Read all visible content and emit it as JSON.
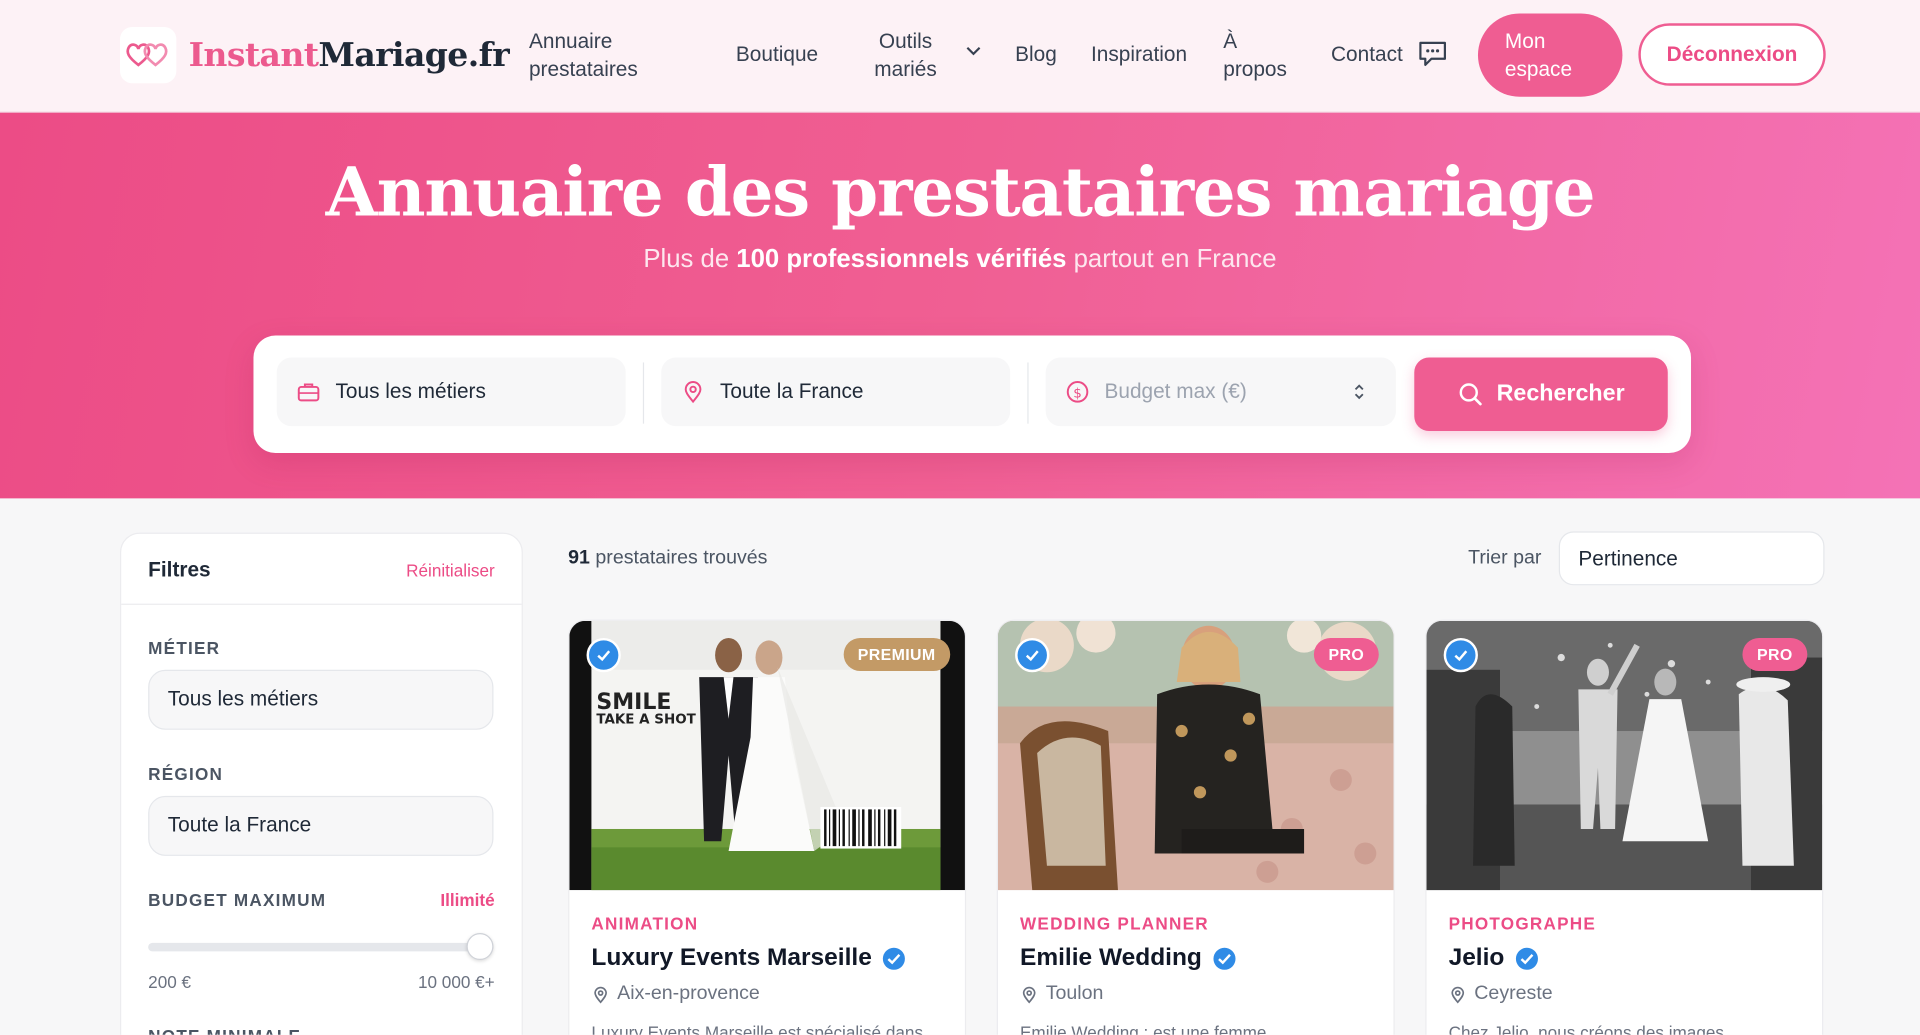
{
  "header": {
    "logo_a": "Instant",
    "logo_b": "Mariage.fr",
    "nav": {
      "annuaire_1": "Annuaire",
      "annuaire_2": "prestataires",
      "boutique": "Boutique",
      "outils_1": "Outils",
      "outils_2": "mariés",
      "blog": "Blog",
      "inspiration": "Inspiration",
      "apropos_1": "À",
      "apropos_2": "propos",
      "contact": "Contact"
    },
    "mon_espace_1": "Mon",
    "mon_espace_2": "espace",
    "deconnexion": "Déconnexion"
  },
  "hero": {
    "title": "Annuaire des prestataires mariage",
    "subtitle_pre": "Plus de ",
    "subtitle_bold": "100 professionnels vérifiés",
    "subtitle_post": " partout en France"
  },
  "search": {
    "metier": "Tous les métiers",
    "region": "Toute la France",
    "budget_placeholder": "Budget max (€)",
    "button": "Rechercher"
  },
  "filters": {
    "title": "Filtres",
    "reset": "Réinitialiser",
    "metier_label": "MÉTIER",
    "metier_value": "Tous les métiers",
    "region_label": "RÉGION",
    "region_value": "Toute la France",
    "budget_label": "BUDGET MAXIMUM",
    "budget_value": "Illimité",
    "budget_level": 1.0,
    "range_min": "200 €",
    "range_max": "10 000 €+",
    "note_label": "NOTE MINIMALE"
  },
  "results": {
    "count": "91",
    "count_suffix": " prestataires trouvés",
    "sort_label": "Trier par",
    "sort_value": "Pertinence"
  },
  "cards": [
    {
      "badge": "PREMIUM",
      "category": "ANIMATION",
      "name": "Luxury Events Marseille",
      "location": "Aix-en-provence",
      "description": "Luxury Events Marseille est spécialisé dans",
      "photo_text_1": "SMILE",
      "photo_text_2": "TAKE A SHOT"
    },
    {
      "badge": "PRO",
      "category": "WEDDING PLANNER",
      "name": "Emilie Wedding",
      "location": "Toulon",
      "description": "Emilie Wedding : est une femme"
    },
    {
      "badge": "PRO",
      "category": "PHOTOGRAPHE",
      "name": "Jelio",
      "location": "Ceyreste",
      "description": "Chez Jelio, nous créons des images"
    }
  ],
  "colors": {
    "accent": "#ef5d92",
    "verified": "#2f8be6",
    "premium": "#c39a66"
  }
}
